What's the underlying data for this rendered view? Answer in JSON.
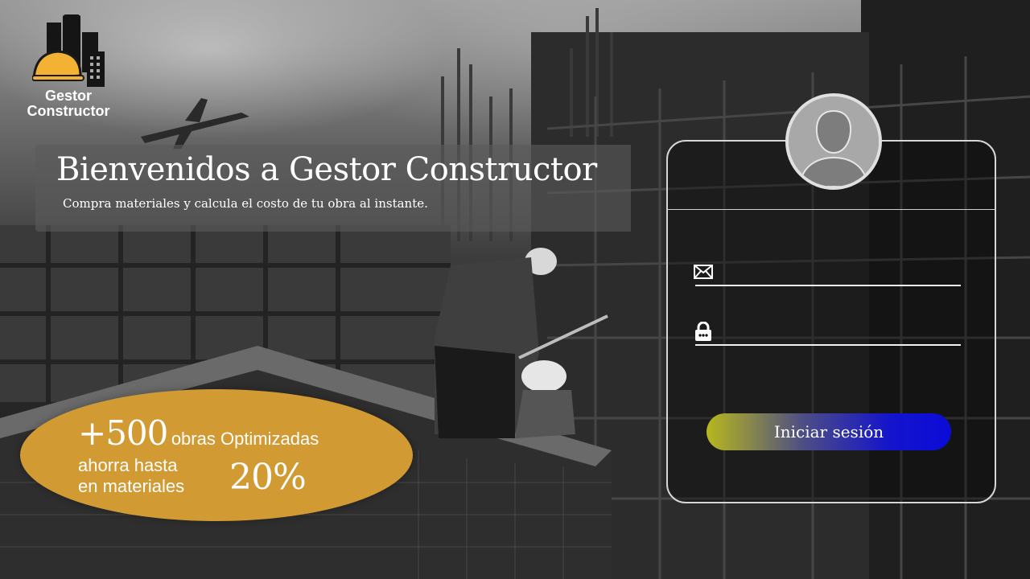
{
  "logo": {
    "line1": "Gestor",
    "line2": "Constructor",
    "icon": "building-hardhat-icon"
  },
  "banner": {
    "title": "Bienvenidos a Gestor Constructor",
    "subtitle": "Compra materiales y calcula el costo de tu obra al instante."
  },
  "promo": {
    "count": "+500",
    "count_text": "obras Optimizadas",
    "save_line1": "ahorra hasta",
    "save_line2": "en materiales",
    "percent": "20%"
  },
  "login": {
    "avatar_icon": "user-avatar-icon",
    "email_icon": "envelope-icon",
    "email_value": "",
    "password_icon": "lock-icon",
    "password_value": "",
    "button_label": "Iniciar sesión"
  },
  "colors": {
    "promo": "#d19a33",
    "button_start": "#b7b71d",
    "button_end": "#0b0bd8"
  }
}
